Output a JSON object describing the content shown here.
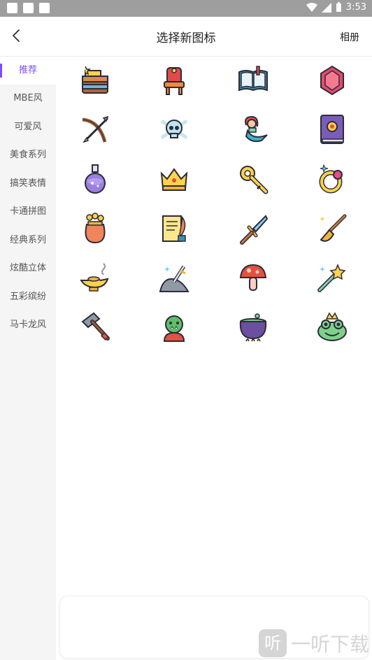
{
  "status_bar": {
    "time": "3:53"
  },
  "header": {
    "title": "选择新图标",
    "album": "相册"
  },
  "sidebar": {
    "items": [
      {
        "label": "推荐",
        "active": true
      },
      {
        "label": "MBE风"
      },
      {
        "label": "可爱风"
      },
      {
        "label": "美食系列"
      },
      {
        "label": "搞笑表情"
      },
      {
        "label": "卡通拼图"
      },
      {
        "label": "经典系列"
      },
      {
        "label": "炫酷立体"
      },
      {
        "label": "五彩缤纷"
      },
      {
        "label": "马卡龙风"
      }
    ]
  },
  "icons": [
    "treasure-chest-icon",
    "throne-icon",
    "spell-book-icon",
    "ruby-gem-icon",
    "crossbow-icon",
    "skull-crossbones-icon",
    "mermaid-icon",
    "magic-tome-icon",
    "potion-bottle-icon",
    "crown-icon",
    "golden-key-icon",
    "magic-ring-icon",
    "gold-sack-icon",
    "scroll-quill-icon",
    "sword-icon",
    "magic-broom-icon",
    "magic-lamp-icon",
    "sword-in-stone-icon",
    "mushroom-icon",
    "magic-wand-icon",
    "battle-hammer-icon",
    "orc-icon",
    "cauldron-icon",
    "frog-prince-icon"
  ],
  "watermark": {
    "badge": "听",
    "text": "一听下载"
  },
  "colors": {
    "accent": "#7b4dff",
    "status_bar": "#9e9e9e",
    "sidebar_bg": "#f5f5f5"
  }
}
